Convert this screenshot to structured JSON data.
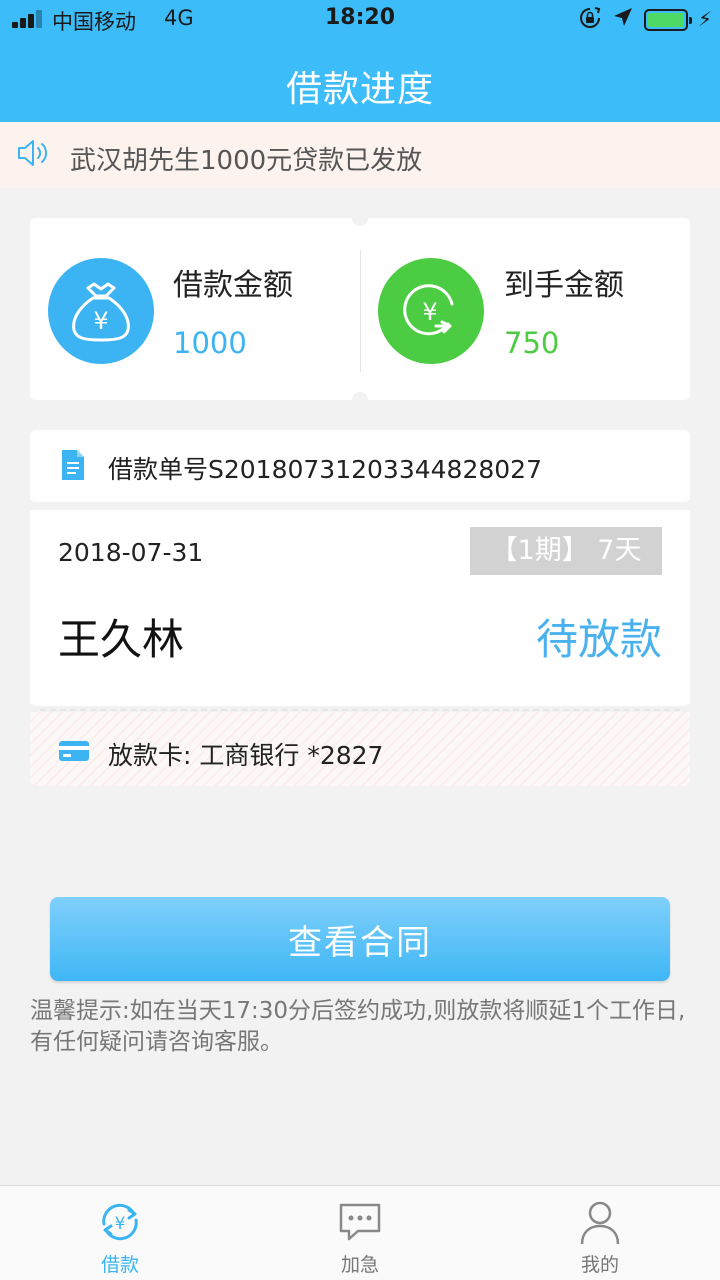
{
  "status_bar": {
    "carrier": "中国移动",
    "network": "4G",
    "time": "18:20",
    "battery_level": 1.0,
    "icons": [
      "signal-icon",
      "rotation-lock-icon",
      "location-icon",
      "battery-icon",
      "charging-icon"
    ]
  },
  "header": {
    "title": "借款进度"
  },
  "notice": {
    "icon": "speaker-icon",
    "text": "武汉胡先生1000元贷款已发放"
  },
  "amounts": {
    "loan": {
      "label": "借款金额",
      "value": "1000",
      "icon": "money-bag-icon",
      "color": "#3cb3f2"
    },
    "received": {
      "label": "到手金额",
      "value": "750",
      "icon": "yuan-return-icon",
      "color": "#4ccc43"
    }
  },
  "loan": {
    "order_label": "借款单号S20180731203344828027",
    "date": "2018-07-31",
    "term": "【1期】 7天",
    "borrower": "王久林",
    "status": "待放款",
    "card": "放款卡: 工商银行 *2827"
  },
  "actions": {
    "view_contract": "查看合同"
  },
  "tip": "温馨提示:如在当天17:30分后签约成功,则放款将顺延1个工作日,有任何疑问请咨询客服。",
  "tabs": [
    {
      "label": "借款",
      "icon": "loan-yuan-icon",
      "active": true
    },
    {
      "label": "加急",
      "icon": "chat-bubble-icon",
      "active": false
    },
    {
      "label": "我的",
      "icon": "profile-icon",
      "active": false
    }
  ],
  "colors": {
    "header": "#3cbcf9",
    "accent": "#49b1ee",
    "green": "#4ccc43"
  }
}
